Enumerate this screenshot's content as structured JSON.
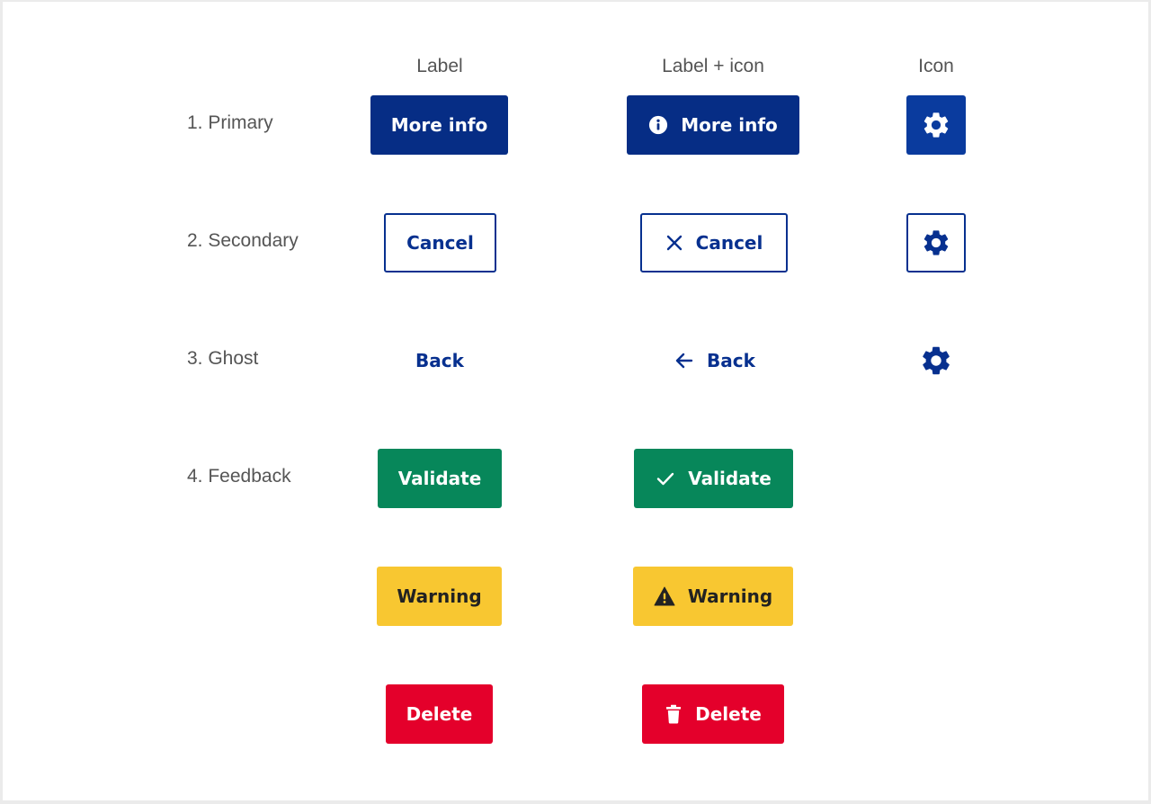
{
  "columns": {
    "label": "Label",
    "label_icon": "Label + icon",
    "icon": "Icon"
  },
  "rows": {
    "primary": "1. Primary",
    "secondary": "2. Secondary",
    "ghost": "3. Ghost",
    "feedback": "4. Feedback"
  },
  "buttons": {
    "primary": {
      "label": "More info",
      "icon": "info-icon",
      "icon_only": "gear-icon"
    },
    "secondary": {
      "label": "Cancel",
      "icon": "close-icon",
      "icon_only": "gear-icon"
    },
    "ghost": {
      "label": "Back",
      "icon": "arrow-left-icon",
      "icon_only": "gear-icon"
    },
    "validate": {
      "label": "Validate",
      "icon": "check-icon"
    },
    "warning": {
      "label": "Warning",
      "icon": "warning-triangle-icon"
    },
    "delete": {
      "label": "Delete",
      "icon": "trash-icon"
    }
  },
  "colors": {
    "primary": "#062d85",
    "secondary_border": "#07308f",
    "success": "#07875a",
    "warning": "#f8c731",
    "danger": "#e4002b",
    "label_text": "#555555"
  }
}
